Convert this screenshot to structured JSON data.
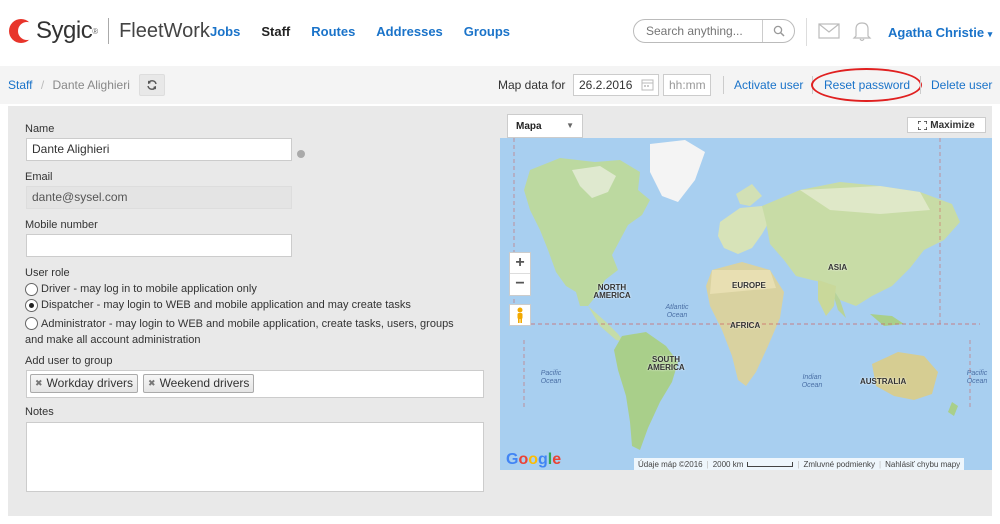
{
  "brand": {
    "name": "Sygic",
    "tm": "®",
    "product": "FleetWork"
  },
  "nav": {
    "items": [
      "Jobs",
      "Staff",
      "Routes",
      "Addresses",
      "Groups"
    ],
    "active": "Staff"
  },
  "search": {
    "placeholder": "Search anything..."
  },
  "user": {
    "name": "Agatha Christie",
    "caret": "▾"
  },
  "breadcrumb": {
    "root": "Staff",
    "separator": "/",
    "current": "Dante Alighieri"
  },
  "mapdata": {
    "label": "Map data for",
    "date": "26.2.2016",
    "time_placeholder": "hh:mm"
  },
  "actions": {
    "activate": "Activate user",
    "reset": "Reset password",
    "delete": "Delete user"
  },
  "form": {
    "name_label": "Name",
    "name_value": "Dante Alighieri",
    "email_label": "Email",
    "email_value": "dante@sysel.com",
    "mobile_label": "Mobile number",
    "mobile_value": "",
    "role_label": "User role",
    "roles": [
      {
        "label": "Driver - may log in to mobile application only",
        "checked": false
      },
      {
        "label": "Dispatcher - may login to WEB and mobile application and may create tasks",
        "checked": true
      },
      {
        "label": "Administrator - may login to WEB and mobile application, create tasks, users, groups and make all account administration",
        "checked": false
      }
    ],
    "group_label": "Add user to group",
    "groups": [
      "Workday drivers",
      "Weekend drivers"
    ],
    "notes_label": "Notes",
    "notes_value": ""
  },
  "map": {
    "type": "Mapa",
    "maximize": "Maximize",
    "zoom_in": "+",
    "zoom_out": "−",
    "google": "Google",
    "attribution": "Údaje máp ©2016",
    "scale": "2000 km",
    "terms": "Zmluvné podmienky",
    "report": "Nahlásiť chybu mapy",
    "labels": {
      "north_america": "NORTH AMERICA",
      "south_america": "SOUTH AMERICA",
      "europe": "EUROPE",
      "africa": "AFRICA",
      "asia": "ASIA",
      "australia": "AUSTRALIA",
      "atlantic": "Atlantic Ocean",
      "pacific_left": "Pacific Ocean",
      "indian": "Indian Ocean",
      "pacific_right": "Pacific Ocean"
    }
  },
  "colors": {
    "link": "#1a73c9",
    "highlight": "#e02020",
    "brand": "#e8352b"
  }
}
